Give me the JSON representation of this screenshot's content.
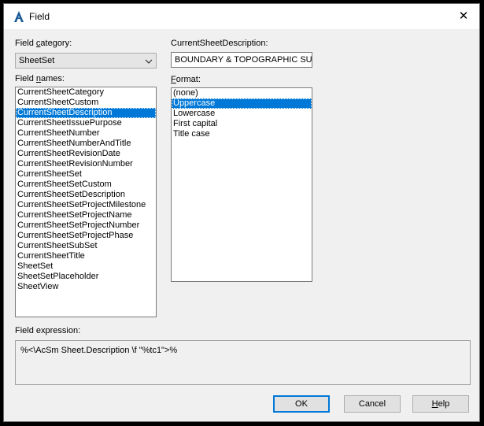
{
  "window": {
    "title": "Field",
    "close_label": "✕"
  },
  "field_category": {
    "label_prefix": "Field ",
    "label_underlined": "c",
    "label_suffix": "ategory:",
    "selected": "SheetSet"
  },
  "field_names": {
    "label_prefix": "Field ",
    "label_underlined": "n",
    "label_suffix": "ames:",
    "items": [
      "CurrentSheetCategory",
      "CurrentSheetCustom",
      "CurrentSheetDescription",
      "CurrentSheetIssuePurpose",
      "CurrentSheetNumber",
      "CurrentSheetNumberAndTitle",
      "CurrentSheetRevisionDate",
      "CurrentSheetRevisionNumber",
      "CurrentSheetSet",
      "CurrentSheetSetCustom",
      "CurrentSheetSetDescription",
      "CurrentSheetSetProjectMilestone",
      "CurrentSheetSetProjectName",
      "CurrentSheetSetProjectNumber",
      "CurrentSheetSetProjectPhase",
      "CurrentSheetSubSet",
      "CurrentSheetTitle",
      "SheetSet",
      "SheetSetPlaceholder",
      "SheetView"
    ],
    "selected_index": 2
  },
  "value": {
    "label": "CurrentSheetDescription:",
    "text": "BOUNDARY & TOPOGRAPHIC SURVI"
  },
  "format": {
    "label_underlined": "F",
    "label_suffix": "ormat:",
    "items": [
      "(none)",
      "Uppercase",
      "Lowercase",
      "First capital",
      "Title case"
    ],
    "selected_index": 1
  },
  "expression": {
    "label": "Field expression:",
    "text": "%<\\AcSm Sheet.Description \\f \"%tc1\">%"
  },
  "buttons": {
    "ok": "OK",
    "cancel": "Cancel",
    "help_underlined": "H",
    "help_suffix": "elp"
  },
  "colors": {
    "selection": "#0078d7",
    "dialog_bg": "#f0f0f0",
    "frame": "#000000"
  },
  "icons": {
    "app": "autocad-logo-icon",
    "dropdown": "chevron-down-icon",
    "close": "close-icon"
  }
}
